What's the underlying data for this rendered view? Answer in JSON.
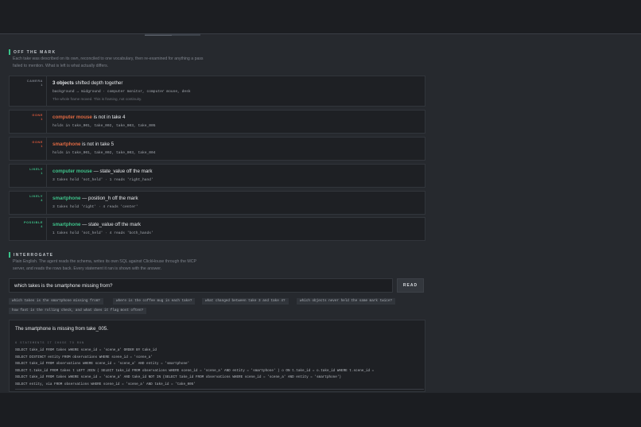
{
  "off_the_mark": {
    "title": "OFF THE MARK",
    "desc1": "Each take was described on its own, reconciled to one vocabulary, then re-examined for anything a pass",
    "desc2": "failed to mention. What is left is what actually differs.",
    "cards": [
      {
        "badge": "CAMERA",
        "badge_num": "1",
        "title_bold": "3 objects",
        "title_rest": " shifted depth together",
        "sub": "background → midground  ·  computer monitor, computer mouse, desk",
        "note": "The whole frame moved. This is framing, not continuity."
      },
      {
        "badge": "GONE",
        "badge_num": "1",
        "entity": "computer mouse",
        "title_rest": " is not in take 4",
        "sub": "holds in take_001, take_002, take_003, take_005"
      },
      {
        "badge": "GONE",
        "badge_num": "1",
        "entity": "smartphone",
        "title_rest": " is not in take 5",
        "sub": "holds in take_001, take_002, take_003, take_004"
      },
      {
        "badge": "LIKELY",
        "badge_num": "1",
        "entity": "computer mouse",
        "title_rest": " — state_value off the mark",
        "sub": "3 takes hold 'not_held'  ·  1 reads 'right_hand'"
      },
      {
        "badge": "LIKELY",
        "badge_num": "4",
        "entity": "smartphone",
        "title_rest": " — position_h off the mark",
        "sub": "3 takes hold 'right'  ·  4 reads 'center'"
      },
      {
        "badge": "POSSIBLE",
        "badge_num": "4",
        "entity": "smartphone",
        "title_rest": " — state_value off the mark",
        "sub": "1 takes hold 'not_held'  ·  4 reads 'both_hands'"
      }
    ]
  },
  "interrogate": {
    "title": "INTERROGATE",
    "desc1": "Plain English. The agent reads the schema, writes its own SQL against ClickHouse through the MCP",
    "desc2": "server, and reads the rows back. Every statement it ran is shown with the answer.",
    "input_value": "which takes is the smartphone missing from?",
    "button_label": "READ",
    "suggestions": [
      "which takes is the smartphone missing from?",
      "where is the coffee mug in each take?",
      "what changed between take 3 and take 4?",
      "which objects never held the same mark twice?",
      "how fast is the rolling check, and what does it flag most often?"
    ],
    "answer": "The smartphone is missing from take_005.",
    "statements_label": "6 STATEMENTS IT CHOSE TO RUN",
    "statements": [
      "SELECT take_id FROM takes WHERE scene_id = 'scene_a' ORDER BY take_id",
      "SELECT DISTINCT entity FROM observations WHERE scene_id = 'scene_a'",
      "SELECT take_id FROM observations WHERE scene_id = 'scene_a' AND entity = 'smartphone'",
      "SELECT t.take_id FROM takes t LEFT JOIN ( SELECT take_id FROM observations WHERE scene_id = 'scene_a' AND entity = 'smartphone' ) o ON t.take_id = o.take_id WHERE t.scene_id =",
      "SELECT take_id FROM takes WHERE scene_id = 'scene_a' AND take_id NOT IN (SELECT take_id FROM observations WHERE scene_id = 'scene_a' AND entity = 'smartphone')",
      "SELECT entity, via FROM observations WHERE scene_id = 'scene_a' AND take_id = 'take_005'"
    ]
  },
  "colors": {
    "accent": "#39c48a",
    "warn": "#d9573b",
    "panel": "#26292e",
    "card": "#1e2024"
  }
}
